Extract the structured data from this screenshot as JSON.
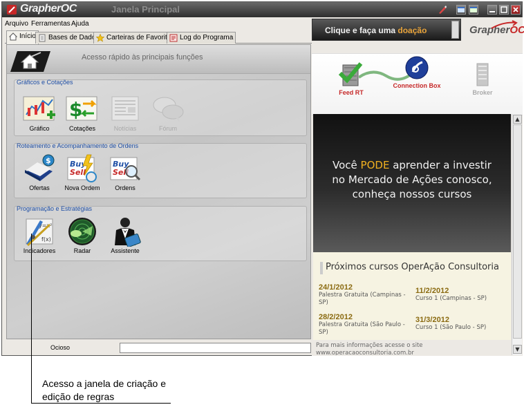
{
  "titlebar": {
    "app_name": "GrapherOC",
    "window_title": "Janela Principal"
  },
  "menu": [
    "Arquivo",
    "Ferramentas",
    "Ajuda"
  ],
  "tabs": [
    {
      "label": "Início",
      "icon": "home-icon"
    },
    {
      "label": "Bases de Dados",
      "icon": "database-icon"
    },
    {
      "label": "Carteiras de Favoritos",
      "icon": "star-icon"
    },
    {
      "label": "Log do Programa",
      "icon": "log-icon"
    }
  ],
  "quick_access": {
    "title": "Acesso rápido às principais funções"
  },
  "groups": [
    {
      "title": "Gráficos e Cotações",
      "items": [
        {
          "label": "Gráfico",
          "icon": "chart-icon",
          "enabled": true
        },
        {
          "label": "Cotações",
          "icon": "quotes-icon",
          "enabled": true
        },
        {
          "label": "Notícias",
          "icon": "news-icon",
          "enabled": false
        },
        {
          "label": "Fórum",
          "icon": "forum-icon",
          "enabled": false
        }
      ]
    },
    {
      "title": "Roteamento e Acompanhamento de Ordens",
      "items": [
        {
          "label": "Ofertas",
          "icon": "offers-icon",
          "enabled": true
        },
        {
          "label": "Nova Ordem",
          "icon": "new-order-icon",
          "enabled": true
        },
        {
          "label": "Ordens",
          "icon": "orders-icon",
          "enabled": true
        }
      ]
    },
    {
      "title": "Programação e Estratégias",
      "items": [
        {
          "label": "Indicadores",
          "icon": "indicators-icon",
          "enabled": true
        },
        {
          "label": "Radar",
          "icon": "radar-icon",
          "enabled": true
        },
        {
          "label": "Assistente",
          "icon": "assistant-icon",
          "enabled": true
        }
      ]
    }
  ],
  "status": {
    "text": "Ocioso"
  },
  "donation": {
    "text_prefix": "Clique e faça uma",
    "text_accent": "doação"
  },
  "brand": {
    "prefix": "Grapher",
    "suffix": "OC"
  },
  "connection": [
    {
      "label": "Feed RT",
      "icon": "feed-rt-icon",
      "color": "#c62828"
    },
    {
      "label": "Connection Box",
      "icon": "connection-box-icon",
      "color": "#c62828"
    },
    {
      "label": "Broker",
      "icon": "broker-icon",
      "color": "#aaaaaa"
    }
  ],
  "banner": {
    "line1_prefix": "Você",
    "line1_accent": "PODE",
    "line1_suffix": "aprender a investir",
    "line2": "no Mercado de Ações conosco,",
    "line3": "conheça nossos cursos"
  },
  "courses": {
    "title": "Próximos cursos OperAção Consultoria",
    "items": [
      {
        "date": "24/1/2012",
        "desc": "Palestra Gratuita (Campinas - SP)"
      },
      {
        "date": "11/2/2012",
        "desc": "Curso 1 (Campinas - SP)"
      },
      {
        "date": "28/2/2012",
        "desc": "Palestra Gratuita (São Paulo - SP)"
      },
      {
        "date": "31/3/2012",
        "desc": "Curso 1 (São Paulo - SP)"
      }
    ]
  },
  "info": {
    "text": "Para mais informações acesse o site",
    "url": "www.operacaoconsultoria.com.br"
  },
  "annotation": {
    "line1": "Acesso a janela de criação e",
    "line2": "edição de regras"
  },
  "colors": {
    "group_title": "#1f4fa5",
    "accent_orange": "#e8a33a",
    "banner_accent": "#f0b020",
    "course_date": "#8a6a10"
  }
}
